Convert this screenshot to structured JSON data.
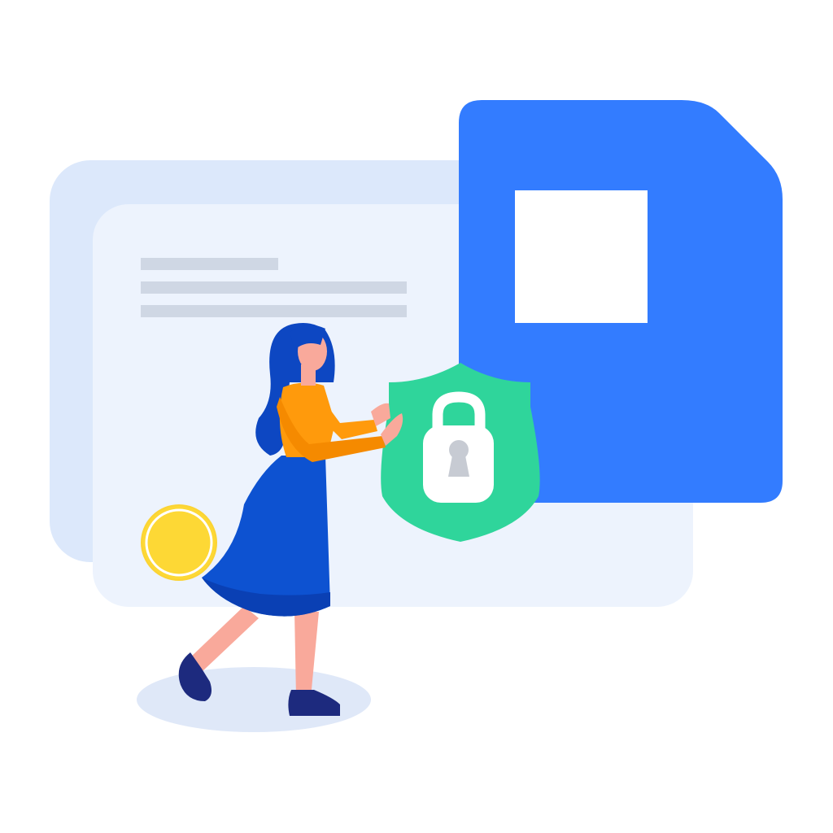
{
  "illustration": {
    "subject": "security-illustration",
    "colors": {
      "background": "#ffffff",
      "back_card": "#dce8fb",
      "front_card": "#edf3fd",
      "text_lines": "#cfd7e4",
      "sd_card": "#337cff",
      "shield": "#2fd59b",
      "coin": "#fdd835",
      "hair": "#0d47c2",
      "skirt": "#0d52d1",
      "top": "#ff9a0c",
      "skin": "#f9a99b",
      "shoes": "#1d2a7e",
      "floor_shadow": "#dfe8f8"
    },
    "icons": [
      "sd-card-icon",
      "shield-icon",
      "padlock-icon",
      "coin-icon",
      "person-figure"
    ]
  }
}
